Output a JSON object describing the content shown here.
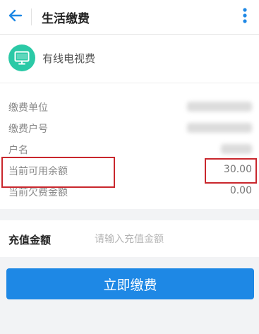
{
  "header": {
    "title": "生活缴费",
    "back_icon": "arrow-left-icon",
    "menu_icon": "more-vertical-icon"
  },
  "service": {
    "name": "有线电视费",
    "icon": "tv-icon",
    "icon_color": "#2bc9a6"
  },
  "info": {
    "rows": [
      {
        "label": "缴费单位",
        "value": ""
      },
      {
        "label": "缴费户号",
        "value": ""
      },
      {
        "label": "户名",
        "value": ""
      },
      {
        "label": "当前可用余额",
        "value": "30.00"
      },
      {
        "label": "当前欠费金额",
        "value": "0.00"
      }
    ]
  },
  "recharge": {
    "label": "充值金额",
    "placeholder": "请输入充值金额"
  },
  "pay_button": {
    "label": "立即缴费",
    "color": "#1e88e5"
  },
  "highlight_color": "#c9272d"
}
